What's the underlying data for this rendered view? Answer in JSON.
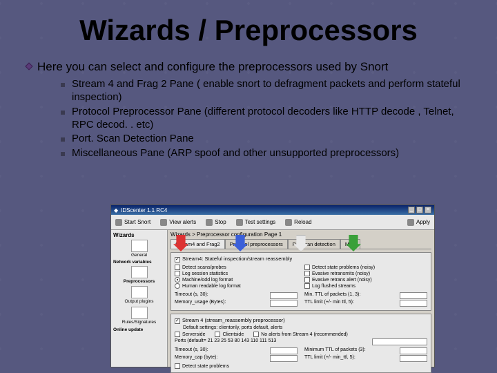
{
  "title": "Wizards / Preprocessors",
  "intro": "Here you can select and configure the preprocessors used by Snort",
  "bullets": [
    "Stream 4 and Frag 2 Pane ( enable snort to defragment packets and perform stateful inspection)",
    "Protocol Preprocessor Pane (different protocol decoders like HTTP decode , Telnet, RPC decod. . etc)",
    "Port. Scan Detection Pane",
    "Miscellaneous Pane  (ARP spoof and other unsupported preprocessors)"
  ],
  "shot": {
    "window_title": "IDScenter 1.1 RC4",
    "toolbar": [
      "Start Snort",
      "View alerts",
      "Stop",
      "Test settings",
      "Reload",
      "Apply"
    ],
    "sidebar": {
      "heading": "Wizards",
      "items": [
        "General",
        "Network variables",
        "Preprocessors",
        "Output plugins",
        "Rules/Signatures",
        "Online update"
      ]
    },
    "crumb": "Wizards > Preprocessor configuration Page 1",
    "tabs": [
      "Stream4 and Frag2",
      "Protocol preprocessors",
      "Portscan detection",
      "Misc"
    ],
    "group1": {
      "title": "Stream4: Stateful inspection/stream reassembly",
      "left_checks": [
        "Detect scans/probes",
        "Log session statistics"
      ],
      "left_radios": [
        "Machine/odd log format",
        "Human readable log format"
      ],
      "right_checks": [
        "Detect state problems (noisy)",
        "Evasive retransmits (noisy)",
        "Evasive retrans alert (noisy)",
        "Log flushed streams"
      ],
      "bottom_left": [
        "Timeout (s, 30):",
        "Memory_usage (Bytes):"
      ],
      "bottom_right": [
        "Min. TTL of packets (1, 3):",
        "TTL limit (+/- min ttl, 5):"
      ]
    },
    "group2": {
      "title": "Stream 4 (stream_reassembly preprocessor)",
      "subtitle": "Default settings: clientonly, ports default, alerts",
      "row_checks": [
        "Serverside",
        "Clientside",
        "No alerts from Stream 4 (recommended)"
      ],
      "ports_label": "Ports (default= 21 23 25 53 80 143 110 111 513",
      "bl_left": [
        "Timeout (s, 30):",
        "Memory_cap (byte):"
      ],
      "bl_right": [
        "Minimum TTL of packets (3):",
        "TTL limit (+/- min_ttl, 5):"
      ],
      "last_check": "Detect state problems"
    }
  }
}
